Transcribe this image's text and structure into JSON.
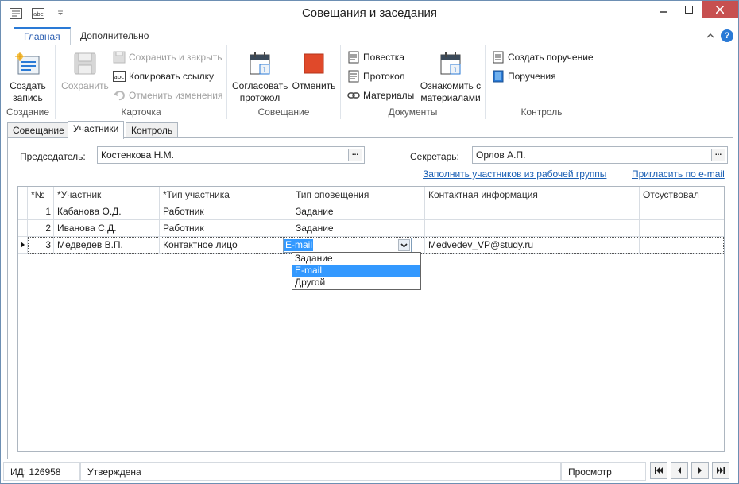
{
  "window": {
    "title": "Совещания и заседания",
    "colors": {
      "accent": "#2a7ad6",
      "close": "#c75050",
      "link": "#1a5fb4",
      "selection": "#3399ff"
    }
  },
  "ribbon": {
    "tabs": [
      {
        "label": "Главная",
        "active": true
      },
      {
        "label": "Дополнительно",
        "active": false
      }
    ],
    "groups": {
      "create": {
        "label": "Создание",
        "create_button": "Создать запись",
        "create_line1": "Создать",
        "create_line2": "запись"
      },
      "card": {
        "label": "Карточка",
        "save": "Сохранить",
        "save_close": "Сохранить и закрыть",
        "copy_link": "Копировать ссылку",
        "undo": "Отменить изменения"
      },
      "meeting": {
        "label": "Совещание",
        "approve_line1": "Согласовать",
        "approve_line2": "протокол",
        "cancel": "Отменить"
      },
      "documents": {
        "label": "Документы",
        "agenda": "Повестка",
        "protocol": "Протокол",
        "materials": "Материалы",
        "acquaint_line1": "Ознакомить с",
        "acquaint_line2": "материалами"
      },
      "control": {
        "label": "Контроль",
        "create_task": "Создать поручение",
        "tasks": "Поручения"
      }
    }
  },
  "content_tabs": [
    {
      "label": "Совещание",
      "active": false
    },
    {
      "label": "Участники",
      "active": true
    },
    {
      "label": "Контроль",
      "active": false
    }
  ],
  "form": {
    "chair_label": "Председатель:",
    "chair_value": "Костенкова Н.М.",
    "secretary_label": "Секретарь:",
    "secretary_value": "Орлов А.П.",
    "fill_link": "Заполнить участников из рабочей группы",
    "invite_link": "Пригласить по e-mail"
  },
  "grid": {
    "columns": [
      "*№",
      "*Участник",
      "*Тип участника",
      "Тип оповещения",
      "Контактная информация",
      "Отсуствовал"
    ],
    "rows": [
      {
        "num": "1",
        "participant": "Кабанова О.Д.",
        "type": "Работник",
        "notify": "Задание",
        "contact": "",
        "absent": ""
      },
      {
        "num": "2",
        "participant": "Иванова С.Д.",
        "type": "Работник",
        "notify": "Задание",
        "contact": "",
        "absent": ""
      },
      {
        "num": "3",
        "participant": "Медведев В.П.",
        "type": "Контактное лицо",
        "notify": "E-mail",
        "contact": "Medvedev_VP@study.ru",
        "absent": ""
      }
    ],
    "dropdown_options": [
      "Задание",
      "E-mail",
      "Другой"
    ],
    "dropdown_selected": "E-mail"
  },
  "status": {
    "id": "ИД: 126958",
    "state": "Утверждена",
    "mode": "Просмотр"
  }
}
